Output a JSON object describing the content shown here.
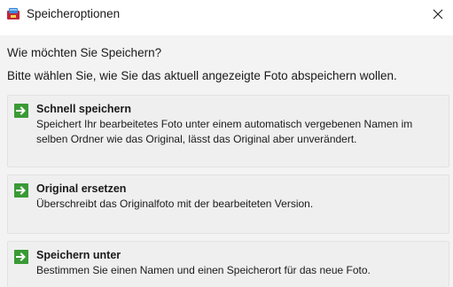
{
  "window": {
    "title": "Speicheroptionen",
    "icon": "save-options-app-icon",
    "close_icon": "close-icon"
  },
  "question": "Wie möchten Sie Speichern?",
  "instruction": "Bitte wählen Sie, wie Sie das aktuell angezeigte Foto abspeichern wollen.",
  "options": [
    {
      "title": "Schnell speichern",
      "description": "Speichert Ihr bearbeitetes Foto unter einem automatisch vergebenen Namen im selben Ordner wie das Original, lässt das Original aber unverändert.",
      "icon": "arrow-right-icon"
    },
    {
      "title": "Original ersetzen",
      "description": "Überschreibt das Originalfoto mit der bearbeiteten Version.",
      "icon": "arrow-right-icon"
    },
    {
      "title": "Speichern unter",
      "description": "Bestimmen Sie einen Namen und einen Speicherort für das neue Foto.",
      "icon": "arrow-right-icon"
    }
  ],
  "colors": {
    "accent_green": "#3a9a35",
    "option_background": "#efefef",
    "dialog_background": "#f3f3f3"
  }
}
